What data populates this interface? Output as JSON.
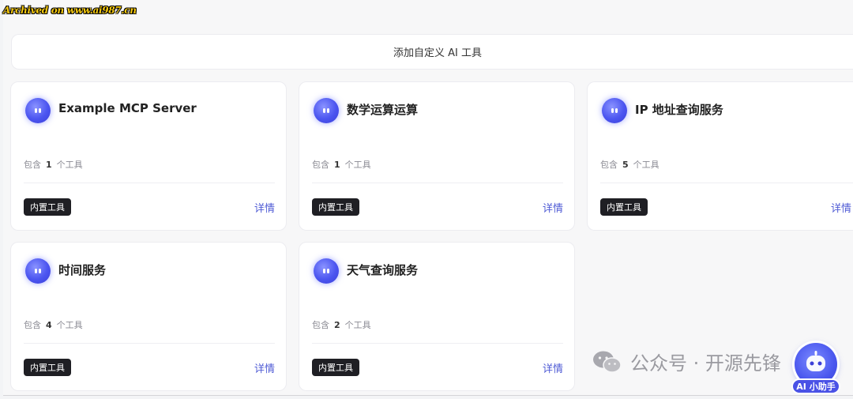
{
  "archive_note": "Archived on www.ai987.cn",
  "add_tool_label": "添加自定义 AI 工具",
  "count_prefix": "包含",
  "count_suffix": "个工具",
  "cards": [
    {
      "title": "Example MCP Server",
      "count": "1",
      "tag": "内置工具",
      "detail": "详情"
    },
    {
      "title": "数学运算运算",
      "count": "1",
      "tag": "内置工具",
      "detail": "详情"
    },
    {
      "title": "IP 地址查询服务",
      "count": "5",
      "tag": "内置工具",
      "detail": "详情"
    },
    {
      "title": "时间服务",
      "count": "4",
      "tag": "内置工具",
      "detail": "详情"
    },
    {
      "title": "天气查询服务",
      "count": "2",
      "tag": "内置工具",
      "detail": "详情"
    }
  ],
  "watermark_text": "公众号 · 开源先锋",
  "assistant_label": "AI 小助手",
  "colors": {
    "accent": "#4f5bd5",
    "tag_bg": "#1f1f24",
    "avatar": "#4b55f0"
  }
}
